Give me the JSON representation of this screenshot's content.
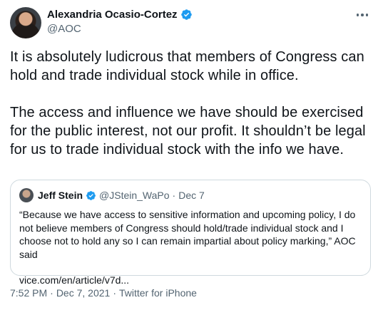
{
  "author": {
    "display_name": "Alexandria Ocasio-Cortez",
    "handle": "@AOC",
    "verified_icon": "verified-badge-icon"
  },
  "tweet": {
    "paragraphs": [
      "It is absolutely ludicrous that members of Congress can hold and trade individual stock while in office.",
      "The access and influence we have should be exercised for the public interest, not our profit. It shouldn’t be legal for us to trade individual stock with the info we have."
    ]
  },
  "quoted_tweet": {
    "display_name": "Jeff Stein",
    "handle": "@JStein_WaPo",
    "separator": "·",
    "date": "Dec 7",
    "text": "“Because we have access to sensitive information and upcoming policy, I do not believe members of Congress should hold/trade individual stock and I choose not to hold any so I can remain impartial about policy marking,” AOC said",
    "link": "vice.com/en/article/v7d..."
  },
  "meta": {
    "time": "7:52 PM",
    "date": "Dec 7, 2021",
    "source": "Twitter for iPhone",
    "separator": "·"
  },
  "colors": {
    "verified_blue": "#1d9bf0",
    "secondary_text": "#536471",
    "border": "#cfd9de"
  }
}
